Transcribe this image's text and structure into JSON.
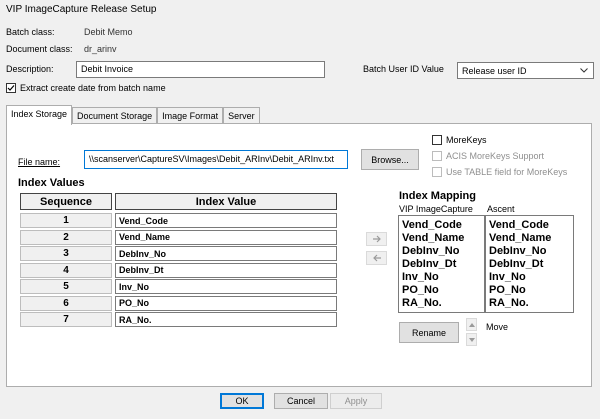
{
  "window": {
    "title": "VIP ImageCapture Release Setup"
  },
  "info": {
    "batch_class_label": "Batch class:",
    "batch_class_value": "Debit Memo",
    "document_class_label": "Document class:",
    "document_class_value": "dr_arinv",
    "description_label": "Description:",
    "description_value": "Debit Invoice",
    "batch_user_label": "Batch User ID Value",
    "batch_user_value": "Release user ID",
    "extract_label": "Extract create date from batch name",
    "extract_checked": true
  },
  "tabs": [
    {
      "label": "Index Storage",
      "active": true
    },
    {
      "label": "Document Storage",
      "active": false
    },
    {
      "label": "Image Format",
      "active": false
    },
    {
      "label": "Server",
      "active": false
    }
  ],
  "index_storage": {
    "file_name_label": "File name:",
    "file_name_value": "\\\\scanserver\\CaptureSV\\Images\\Debit_ARInv\\Debit_ARInv.txt",
    "browse_label": "Browse...",
    "morekeys_label": "MoreKeys",
    "acis_label": "ACIS MoreKeys Support",
    "table_field_label": "Use TABLE field for MoreKeys",
    "index_values_title": "Index Values",
    "sequence_header": "Sequence",
    "index_value_header": "Index Value",
    "rows": [
      {
        "seq": "1",
        "value": "Vend_Code"
      },
      {
        "seq": "2",
        "value": "Vend_Name"
      },
      {
        "seq": "3",
        "value": "DebInv_No"
      },
      {
        "seq": "4",
        "value": "DebInv_Dt"
      },
      {
        "seq": "5",
        "value": "Inv_No"
      },
      {
        "seq": "6",
        "value": "PO_No"
      },
      {
        "seq": "7",
        "value": "RA_No."
      }
    ],
    "index_mapping_title": "Index Mapping",
    "vip_col_label": "VIP ImageCapture",
    "ascent_col_label": "Ascent",
    "vip_items": [
      "Vend_Code",
      "Vend_Name",
      "DebInv_No",
      "DebInv_Dt",
      "Inv_No",
      "PO_No",
      "RA_No."
    ],
    "ascent_items": [
      "Vend_Code",
      "Vend_Name",
      "DebInv_No",
      "DebInv_Dt",
      "Inv_No",
      "PO_No",
      "RA_No."
    ],
    "rename_label": "Rename",
    "move_label": "Move",
    "icons": {
      "add": "arrow-right-icon",
      "remove": "arrow-left-icon",
      "up": "triangle-up-icon",
      "down": "triangle-down-icon"
    }
  },
  "footer": {
    "ok_label": "OK",
    "cancel_label": "Cancel",
    "apply_label": "Apply"
  },
  "colors": {
    "accent": "#0078d7",
    "window_bg": "#f0f0f0",
    "panel_bg": "#ffffff"
  }
}
